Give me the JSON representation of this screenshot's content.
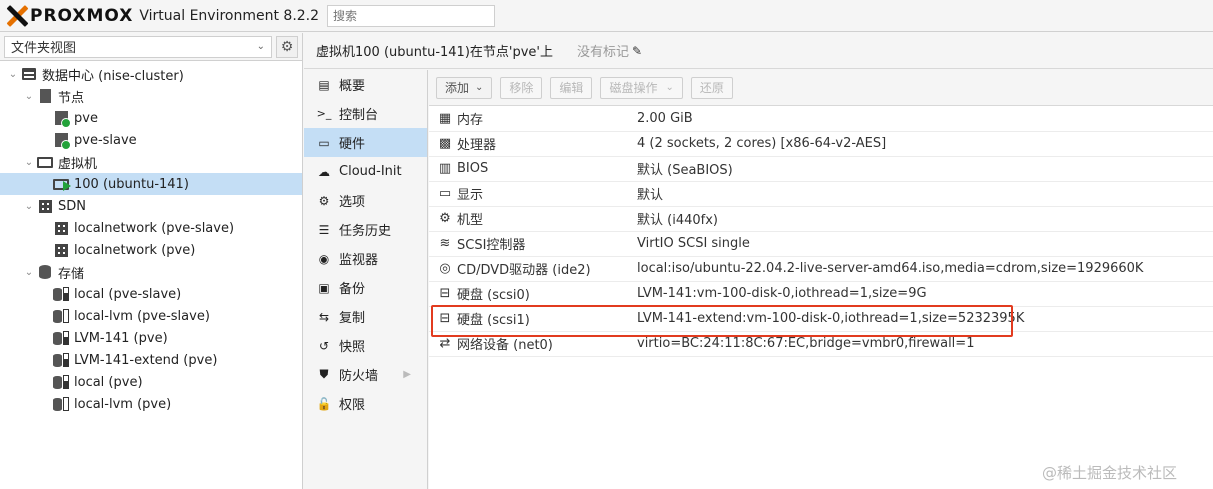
{
  "header": {
    "logo_text": "PROXMOX",
    "version": "Virtual Environment 8.2.2",
    "search_placeholder": "搜索"
  },
  "left_panel": {
    "view_select": "文件夹视图",
    "tree": [
      {
        "label": "数据中心 (nise-cluster)",
        "icon": "server-icon",
        "level": 0,
        "twisty": "open"
      },
      {
        "label": "节点",
        "icon": "building-icon",
        "level": 1,
        "twisty": "open"
      },
      {
        "label": "pve",
        "icon": "node-online-icon",
        "level": 2
      },
      {
        "label": "pve-slave",
        "icon": "node-online-icon",
        "level": 2
      },
      {
        "label": "虚拟机",
        "icon": "monitor-icon",
        "level": 1,
        "twisty": "open"
      },
      {
        "label": "100 (ubuntu-141)",
        "icon": "vm-running-icon",
        "level": 2,
        "selected": true
      },
      {
        "label": "SDN",
        "icon": "grid-icon",
        "level": 1,
        "twisty": "open"
      },
      {
        "label": "localnetwork (pve-slave)",
        "icon": "network-grid-icon",
        "level": 2
      },
      {
        "label": "localnetwork (pve)",
        "icon": "network-grid-icon",
        "level": 2
      },
      {
        "label": "存储",
        "icon": "database-icon",
        "level": 1,
        "twisty": "open"
      },
      {
        "label": "local (pve-slave)",
        "icon": "storage-icon",
        "level": 2,
        "fill": true
      },
      {
        "label": "local-lvm (pve-slave)",
        "icon": "storage-icon",
        "level": 2,
        "fill": false
      },
      {
        "label": "LVM-141 (pve)",
        "icon": "storage-icon",
        "level": 2,
        "fill": true
      },
      {
        "label": "LVM-141-extend (pve)",
        "icon": "storage-icon",
        "level": 2,
        "fill": true
      },
      {
        "label": "local (pve)",
        "icon": "storage-icon",
        "level": 2,
        "fill": true
      },
      {
        "label": "local-lvm (pve)",
        "icon": "storage-icon",
        "level": 2,
        "fill": false
      }
    ]
  },
  "content_header": {
    "title": "虚拟机100 (ubuntu-141)在节点'pve'上",
    "tags": "没有标记"
  },
  "subnav": [
    {
      "label": "概要",
      "icon": "book-icon",
      "glyph": "▤"
    },
    {
      "label": "控制台",
      "icon": "terminal-icon",
      "glyph": ">_"
    },
    {
      "label": "硬件",
      "icon": "desktop-icon",
      "glyph": "▭",
      "active": true
    },
    {
      "label": "Cloud-Init",
      "icon": "cloud-icon",
      "glyph": "☁"
    },
    {
      "label": "选项",
      "icon": "gear-icon",
      "glyph": "⚙"
    },
    {
      "label": "任务历史",
      "icon": "list-icon",
      "glyph": "☰"
    },
    {
      "label": "监视器",
      "icon": "eye-icon",
      "glyph": "◉"
    },
    {
      "label": "备份",
      "icon": "floppy-icon",
      "glyph": "▣"
    },
    {
      "label": "复制",
      "icon": "retweet-icon",
      "glyph": "⇆"
    },
    {
      "label": "快照",
      "icon": "history-icon",
      "glyph": "↺"
    },
    {
      "label": "防火墙",
      "icon": "shield-icon",
      "glyph": "⛊",
      "arrow": true
    },
    {
      "label": "权限",
      "icon": "unlock-icon",
      "glyph": "🔓"
    }
  ],
  "toolbar": {
    "add": "添加",
    "remove": "移除",
    "edit": "编辑",
    "disk_action": "磁盘操作",
    "revert": "还原"
  },
  "hardware": [
    {
      "icon": "memory-icon",
      "glyph": "▦",
      "name": "内存",
      "value": "2.00 GiB"
    },
    {
      "icon": "cpu-icon",
      "glyph": "▩",
      "name": "处理器",
      "value": "4 (2 sockets, 2 cores) [x86-64-v2-AES]"
    },
    {
      "icon": "microchip-icon",
      "glyph": "▥",
      "name": "BIOS",
      "value": "默认 (SeaBIOS)"
    },
    {
      "icon": "desktop-icon",
      "glyph": "▭",
      "name": "显示",
      "value": "默认"
    },
    {
      "icon": "cogs-icon",
      "glyph": "⚙",
      "name": "机型",
      "value": "默认 (i440fx)"
    },
    {
      "icon": "database-icon",
      "glyph": "≋",
      "name": "SCSI控制器",
      "value": "VirtIO SCSI single"
    },
    {
      "icon": "cdrom-icon",
      "glyph": "◎",
      "name": "CD/DVD驱动器 (ide2)",
      "value": "local:iso/ubuntu-22.04.2-live-server-amd64.iso,media=cdrom,size=1929660K"
    },
    {
      "icon": "hdd-icon",
      "glyph": "⊟",
      "name": "硬盘 (scsi0)",
      "value": "LVM-141:vm-100-disk-0,iothread=1,size=9G"
    },
    {
      "icon": "hdd-icon",
      "glyph": "⊟",
      "name": "硬盘 (scsi1)",
      "value": "LVM-141-extend:vm-100-disk-0,iothread=1,size=5232395K",
      "highlighted": true
    },
    {
      "icon": "exchange-icon",
      "glyph": "⇄",
      "name": "网络设备 (net0)",
      "value": "virtio=BC:24:11:8C:67:EC,bridge=vmbr0,firewall=1"
    }
  ],
  "watermark": "@稀土掘金技术社区",
  "colors": {
    "selected_bg": "#c4def5",
    "highlight_border": "#e23b1f",
    "status_green": "#23a23a",
    "logo_orange": "#e57000"
  }
}
